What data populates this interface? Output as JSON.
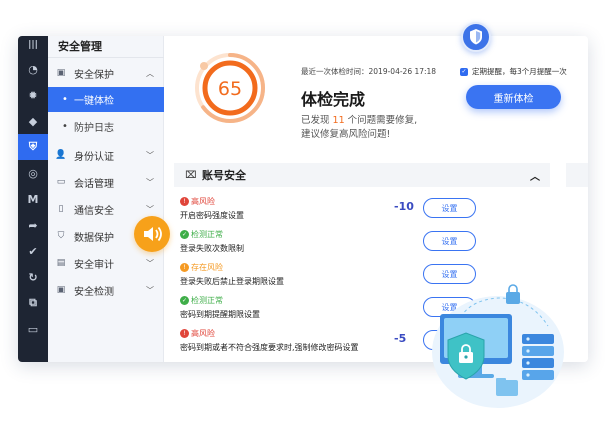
{
  "sidebar": {
    "title": "安全管理",
    "items": [
      {
        "label": "安全保护",
        "expanded": true
      },
      {
        "label": "身份认证"
      },
      {
        "label": "会话管理"
      },
      {
        "label": "通信安全"
      },
      {
        "label": "数据保护"
      },
      {
        "label": "安全审计"
      },
      {
        "label": "安全检测"
      }
    ],
    "subitems": [
      {
        "label": "一键体检",
        "active": true
      },
      {
        "label": "防护日志"
      }
    ]
  },
  "rail": {
    "m_label": "M"
  },
  "score": {
    "value": "65",
    "level": 0.65,
    "color": "#f26b1d"
  },
  "check": {
    "last_check": "最近一次体检时间：2019-04-26 17:18",
    "title": "体检完成",
    "desc_prefix": "已发现 ",
    "issue_count": "11",
    "desc_suffix": " 个问题需要修复,",
    "desc_line2": "建议修复高风险问题!",
    "recheck_label": "重新体检",
    "remind_label": "定期提醒，每3个月提醒一次"
  },
  "section": {
    "title": "账号安全"
  },
  "rows": [
    {
      "status": "高风险",
      "status_color": "#e0453a",
      "desc": "开启密码强度设置",
      "delta": "-10",
      "button": "设置"
    },
    {
      "status": "检测正常",
      "status_color": "#3fae49",
      "desc": "登录失败次数限制",
      "delta": "",
      "button": "设置"
    },
    {
      "status": "存在风险",
      "status_color": "#f59a23",
      "desc": "登录失败后禁止登录期限设置",
      "delta": "",
      "button": "设置"
    },
    {
      "status": "检测正常",
      "status_color": "#3fae49",
      "desc": "密码到期提醒期限设置",
      "delta": "",
      "button": "设置"
    },
    {
      "status": "高风险",
      "status_color": "#e0453a",
      "desc": "密码到期或者不符合强度要求时,强制修改密码设置",
      "delta": "-5",
      "button": "设置"
    }
  ],
  "colors": {
    "accent": "#3a74f2",
    "rail": "#1e2533"
  }
}
